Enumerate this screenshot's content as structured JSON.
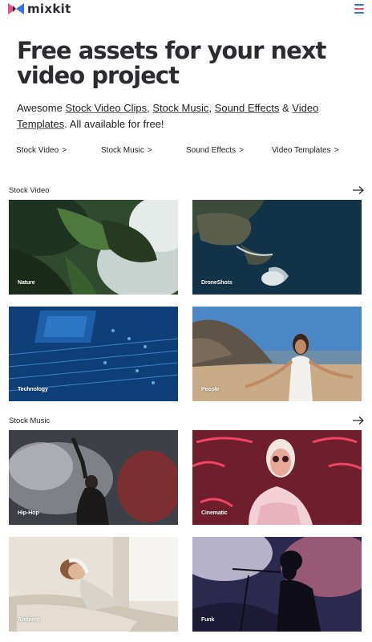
{
  "header": {
    "logo_text": "mixkit",
    "logo_icon": "mixkit-logo-icon",
    "menu_icon": "hamburger-menu-icon",
    "colors": {
      "brand_blue": "#3c6fe6",
      "brand_pink": "#e8508b",
      "text": "#2b2b30"
    }
  },
  "hero": {
    "title": "Free assets for your next video project",
    "subtitle_prefix": "Awesome ",
    "link_video_clips": "Stock Video Clips",
    "sep1": ", ",
    "link_music": "Stock Music",
    "sep2": ", ",
    "link_sfx": "Sound Effects",
    "sep3": " & ",
    "link_templates": "Video Templates",
    "subtitle_suffix": ". All available for free!"
  },
  "quick_links": [
    {
      "label": "Stock Video",
      "icon": "chevron-right-icon"
    },
    {
      "label": "Stock Music",
      "icon": "chevron-right-icon"
    },
    {
      "label": "Sound Effects",
      "icon": "chevron-right-icon"
    },
    {
      "label": "Video Templates",
      "icon": "chevron-right-icon"
    }
  ],
  "chevron": ">",
  "stock_video": {
    "title": "Stock Video",
    "arrow_icon": "arrow-right-icon",
    "cards": [
      {
        "label": "Nature"
      },
      {
        "label": "DroneShots"
      },
      {
        "label": "Technology"
      },
      {
        "label": "People"
      }
    ]
  },
  "stock_music": {
    "title": "Stock Music",
    "arrow_icon": "arrow-right-icon",
    "cards": [
      {
        "label": "Hip-Hop"
      },
      {
        "label": "Cinematic"
      },
      {
        "label": "Ambient"
      },
      {
        "label": "Funk"
      }
    ]
  }
}
